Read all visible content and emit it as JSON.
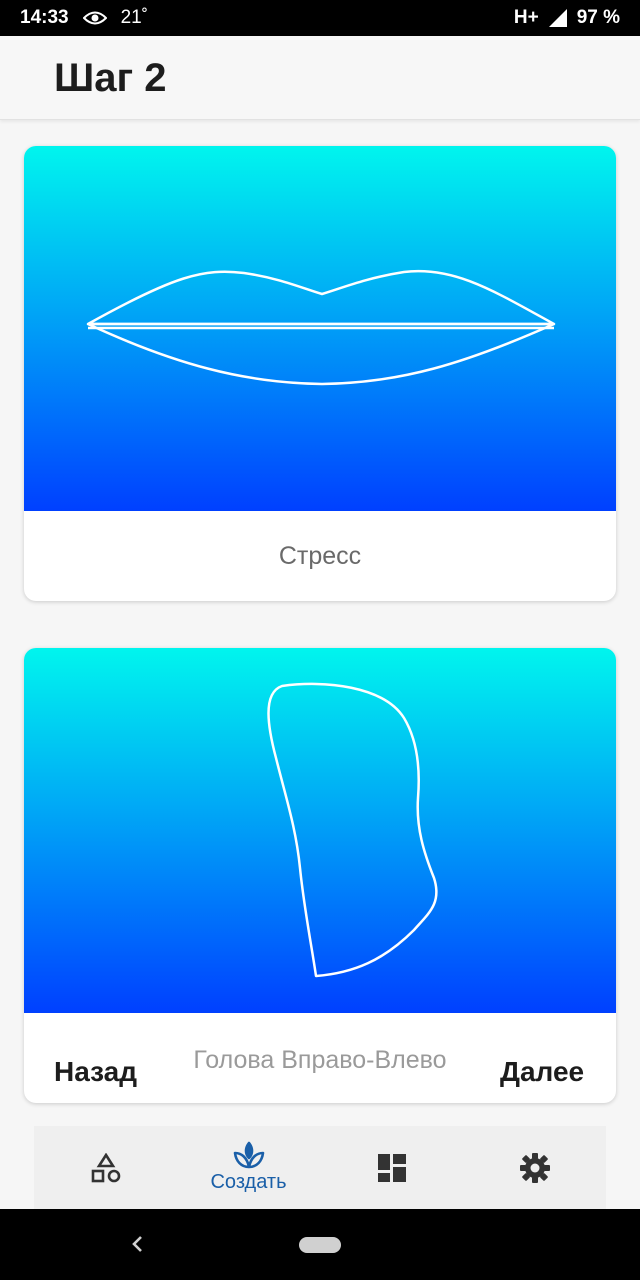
{
  "status_bar": {
    "time": "14:33",
    "temperature": "21˚",
    "network": "H+",
    "battery": "97 %"
  },
  "header": {
    "title": "Шаг 2"
  },
  "cards": [
    {
      "label": "Стресс",
      "icon": "lips-outline"
    },
    {
      "label": "Голова Вправо-Влево",
      "icon": "head-shape-outline"
    }
  ],
  "navigation": {
    "back_label": "Назад",
    "next_label": "Далее"
  },
  "bottom_nav": {
    "items": [
      {
        "icon": "shapes-icon",
        "label": ""
      },
      {
        "icon": "lotus-icon",
        "label": "Создать",
        "active": true
      },
      {
        "icon": "dashboard-icon",
        "label": ""
      },
      {
        "icon": "gear-icon",
        "label": ""
      }
    ],
    "active_color": "#1a5fa8"
  },
  "colors": {
    "gradient_top": "#00f5ee",
    "gradient_bottom": "#0040ff"
  }
}
